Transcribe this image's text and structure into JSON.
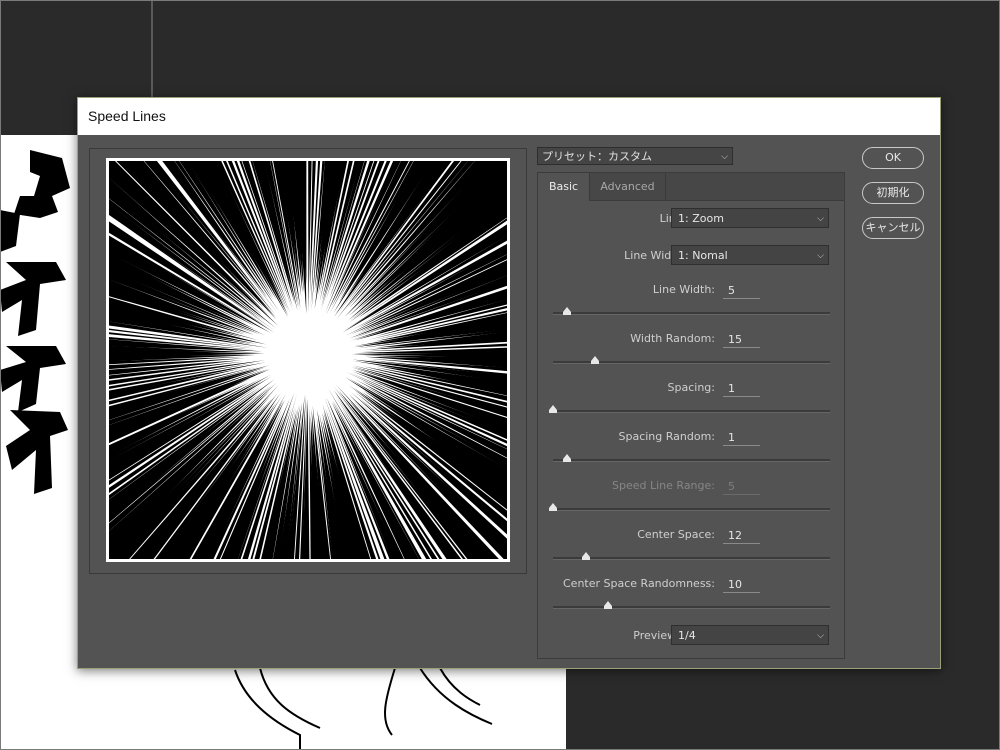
{
  "dialog": {
    "title": "Speed Lines",
    "preset": {
      "value": "プリセット：カスタム",
      "icon": "chevron-down-icon"
    },
    "buttons": {
      "ok": "OK",
      "reset": "初期化",
      "cancel": "キャンセル"
    },
    "tabs": [
      {
        "label": "Basic",
        "active": true
      },
      {
        "label": "Advanced",
        "active": false
      }
    ],
    "basic": {
      "line_type": {
        "label": "Line Type:",
        "value": "1: Zoom"
      },
      "line_width_type": {
        "label": "Line Width Type:",
        "value": "1: Nomal"
      },
      "sliders": [
        {
          "key": "line_width",
          "label": "Line Width:",
          "value": "5",
          "fraction": 0.05,
          "disabled": false
        },
        {
          "key": "width_random",
          "label": "Width Random:",
          "value": "15",
          "fraction": 0.15,
          "disabled": false
        },
        {
          "key": "spacing",
          "label": "Spacing:",
          "value": "1",
          "fraction": 0.0,
          "disabled": false
        },
        {
          "key": "spacing_random",
          "label": "Spacing Random:",
          "value": "1",
          "fraction": 0.05,
          "disabled": false
        },
        {
          "key": "speed_line_range",
          "label": "Speed Line Range:",
          "value": "5",
          "fraction": 0.0,
          "disabled": true
        },
        {
          "key": "center_space",
          "label": "Center Space:",
          "value": "12",
          "fraction": 0.12,
          "disabled": false
        },
        {
          "key": "center_space_randomness",
          "label": "Center Space Randomness:",
          "value": "10",
          "fraction": 0.2,
          "disabled": false
        }
      ],
      "preview_zoom": {
        "label": "Preview Zoom:",
        "value": "1/4"
      }
    }
  },
  "background": {
    "manga_text": "ゴオオオ"
  },
  "colors": {
    "dialog_bg": "#535353",
    "titlebar_bg": "#ffffff",
    "workspace_bg": "#2a2a2a"
  }
}
